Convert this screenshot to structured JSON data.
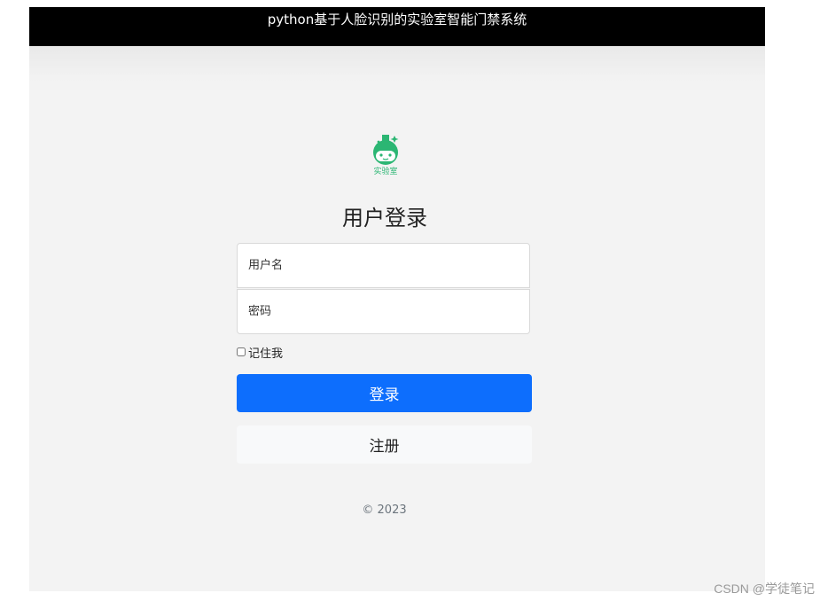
{
  "window": {
    "title": "python基于人脸识别的实验室智能门禁系统"
  },
  "logo": {
    "icon": "flask-face-icon",
    "text": "实验室",
    "color": "#2bb673"
  },
  "login_form": {
    "heading": "用户登录",
    "username_placeholder": "用户名",
    "password_placeholder": "密码",
    "remember_label": "记住我",
    "remember_checked": false,
    "login_button": "登录",
    "register_button": "注册"
  },
  "footer": {
    "copyright": "© 2023"
  },
  "watermark": {
    "text": "CSDN @学徒笔记"
  },
  "colors": {
    "title_bar": "#000000",
    "background": "#f3f3f3",
    "primary": "#0d6efd",
    "secondary": "#f8f9fa"
  }
}
